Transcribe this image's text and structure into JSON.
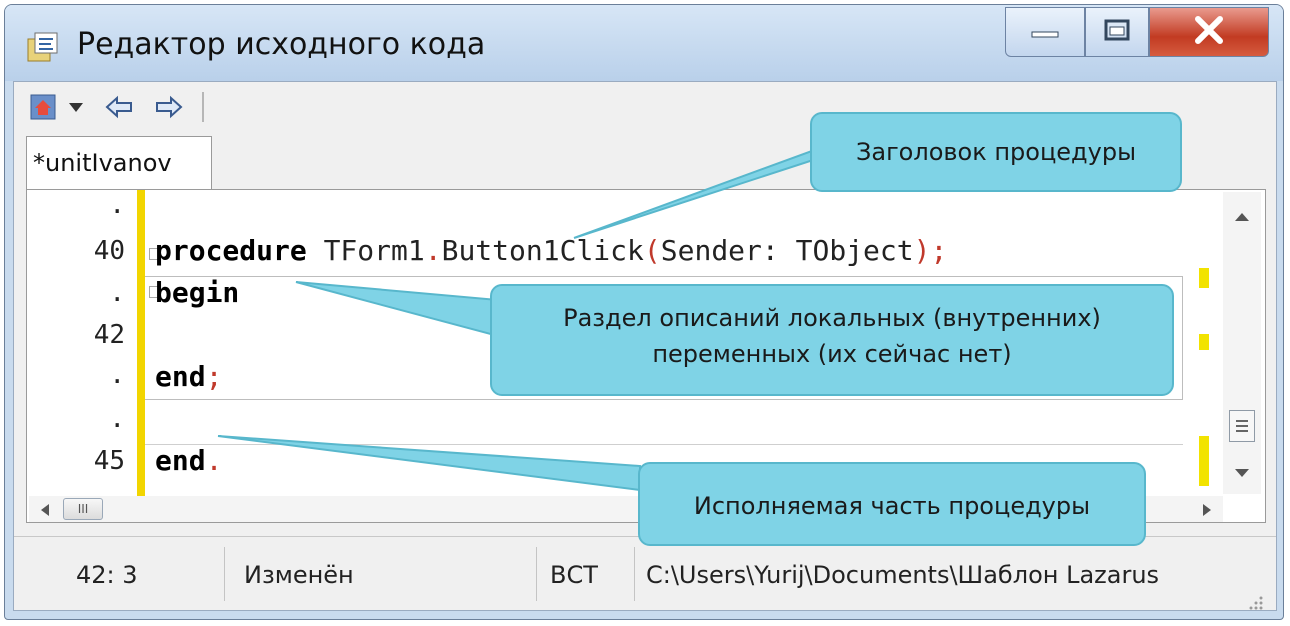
{
  "window": {
    "title": "Редактор исходного кода"
  },
  "tabs": [
    {
      "label": "*unitIvanov"
    }
  ],
  "gutter": {
    "lines": [
      ".",
      "40",
      ".",
      "42",
      ".",
      ".",
      "45"
    ]
  },
  "code": {
    "line1": {
      "keyword": "procedure",
      "rest": " TForm1",
      "dot": ".",
      "name": "Button1Click",
      "open": "(",
      "params": "Sender: TObject",
      "close": ");"
    },
    "line2": {
      "keyword": "begin"
    },
    "line3": {
      "keyword": "end",
      "semicolon": ";"
    },
    "line4": {
      "keyword": "end",
      "dot": "."
    }
  },
  "statusbar": {
    "position": "42:  3",
    "state": "Изменён",
    "mode": "ВСТ",
    "path": "C:\\Users\\Yurij\\Documents\\Шаблон Lazarus"
  },
  "callouts": {
    "header": "Заголовок процедуры",
    "locals_line1": "Раздел описаний локальных (внутренних)",
    "locals_line2": "переменных (их сейчас нет)",
    "body": "Исполняемая часть процедуры"
  },
  "scrollbar": {
    "thumb_glyph": "III"
  },
  "icons": {
    "app": "app-icon",
    "minimize": "minimize-icon",
    "maximize": "maximize-icon",
    "close": "close-icon",
    "toolbar_home": "home-icon",
    "toolbar_dropdown": "chevron-down-icon",
    "toolbar_back": "back-arrow-icon",
    "toolbar_forward": "forward-arrow-icon"
  },
  "colors": {
    "callout_fill": "#7fd3e6",
    "gutter_mark": "#f2d500",
    "close_button": "#c23b22"
  }
}
